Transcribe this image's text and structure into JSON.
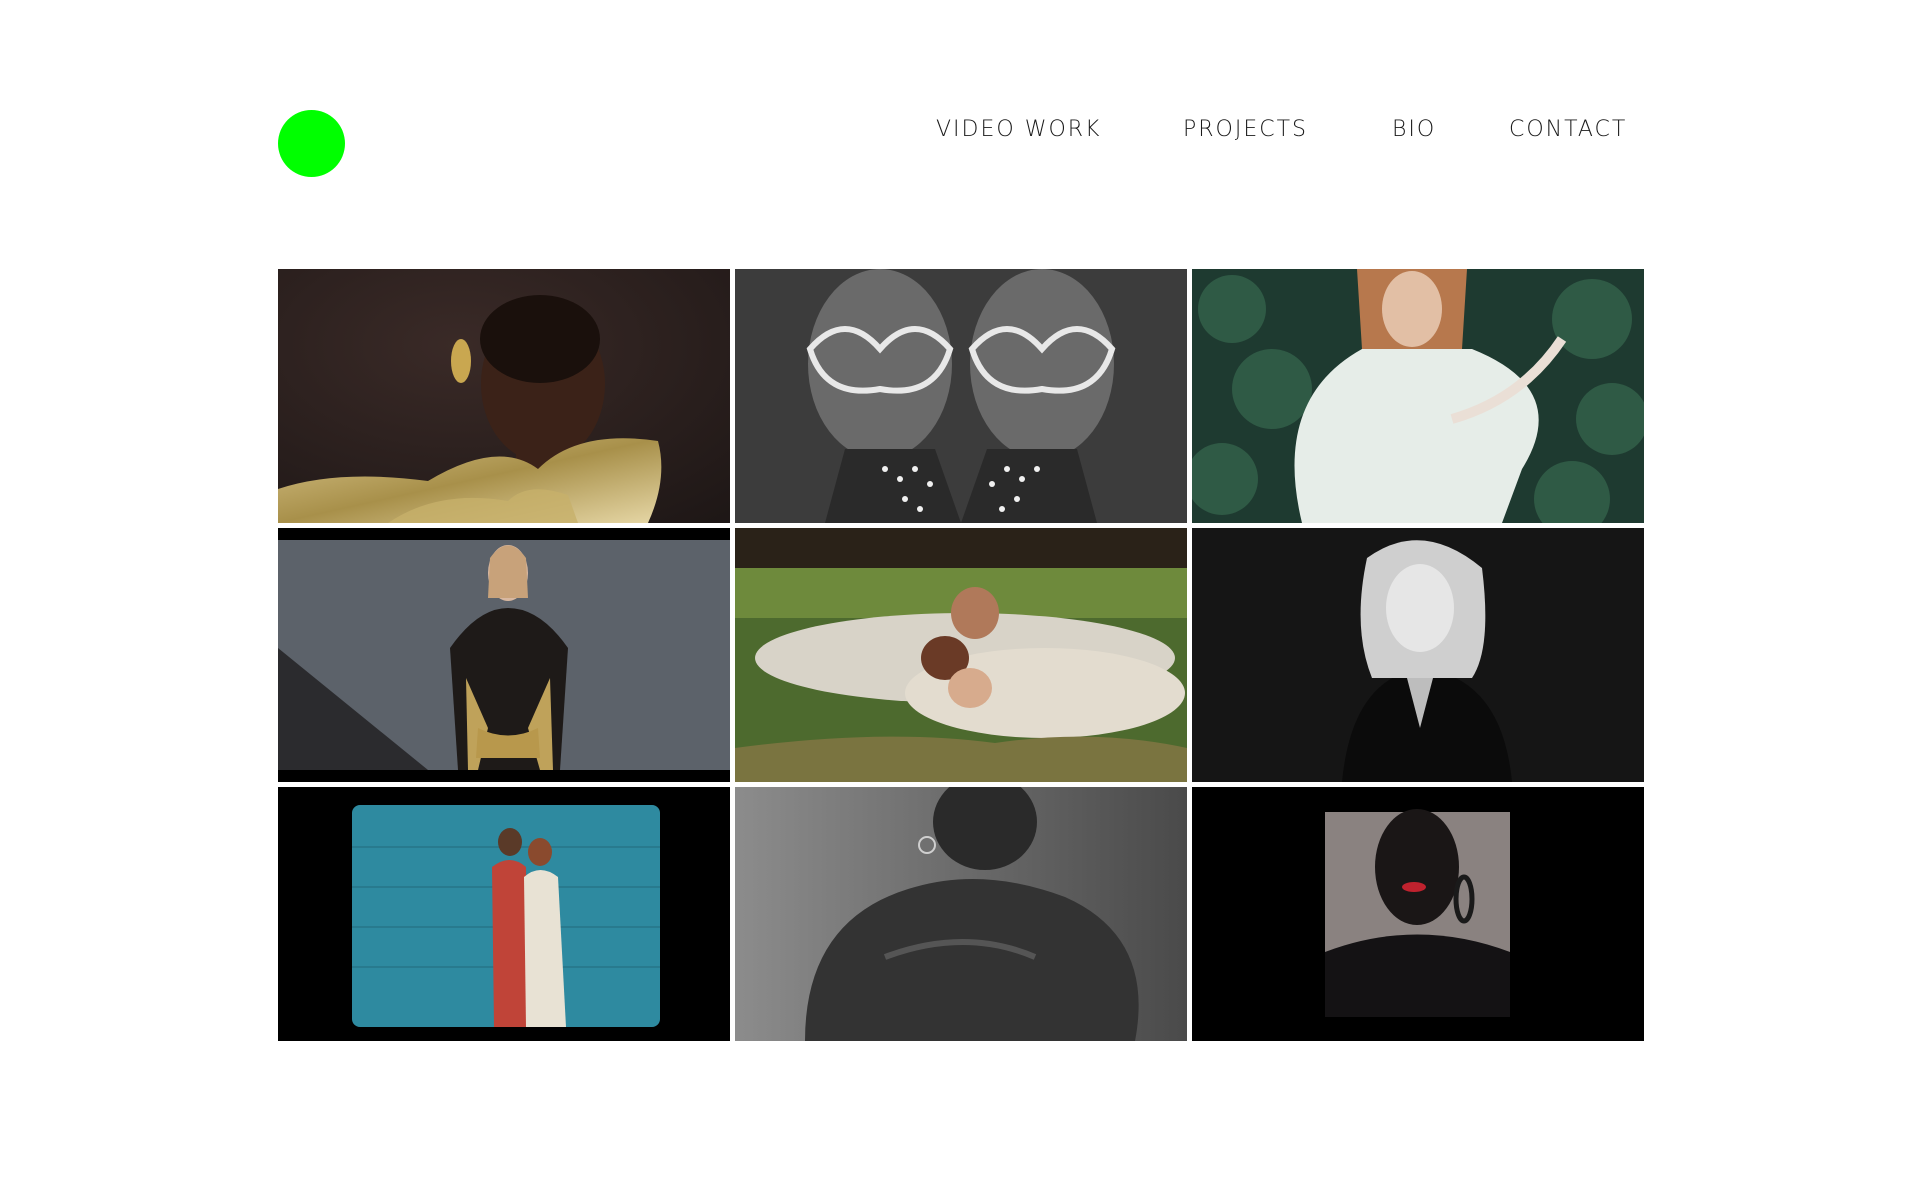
{
  "logo": {
    "color": "#00ff00"
  },
  "nav": {
    "items": [
      {
        "label": "VIDEO WORK"
      },
      {
        "label": "PROJECTS"
      },
      {
        "label": "BIO"
      },
      {
        "label": "CONTACT"
      }
    ]
  },
  "grid": {
    "tiles": [
      {
        "thumbnail": "portrait-gold-ruffle-dress"
      },
      {
        "thumbnail": "mirrored-jeweled-mask"
      },
      {
        "thumbnail": "woman-sheer-white-blouse-greenery"
      },
      {
        "thumbnail": "woman-gold-black-jacket-wall"
      },
      {
        "thumbnail": "three-women-lying-grass"
      },
      {
        "thumbnail": "blonde-woman-black-blazer"
      },
      {
        "thumbnail": "couple-blue-wall-film-frame"
      },
      {
        "thumbnail": "man-bare-back-monochrome"
      },
      {
        "thumbnail": "shadowed-face-red-lips-earring"
      }
    ]
  }
}
